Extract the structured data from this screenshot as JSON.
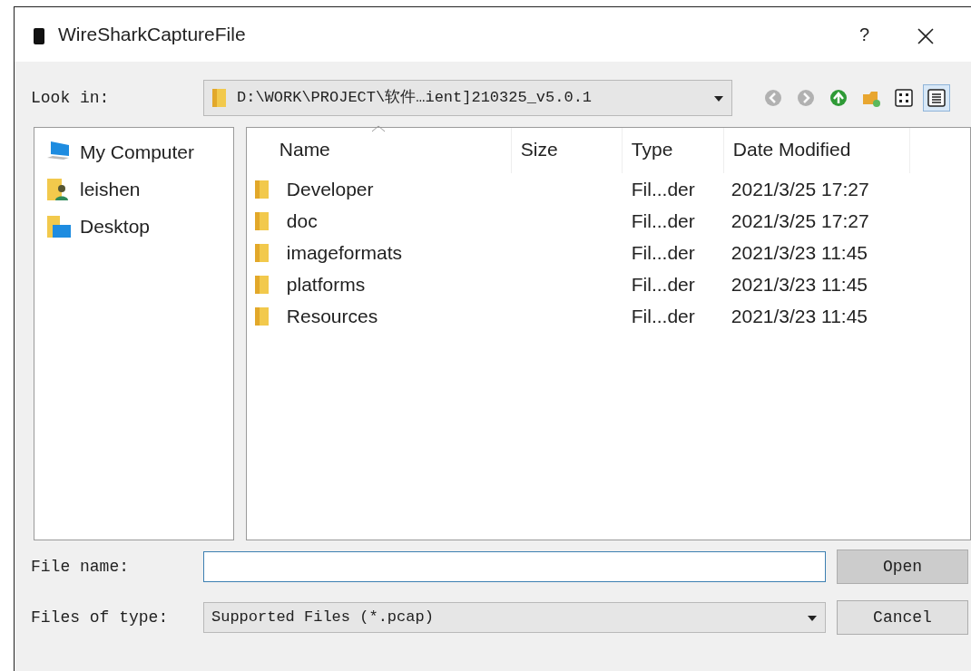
{
  "window": {
    "title": "WireSharkCaptureFile",
    "help": "?"
  },
  "look_in": {
    "label": "Look in:",
    "path": "D:\\WORK\\PROJECT\\软件…ient]210325_v5.0.1"
  },
  "toolbar": [
    {
      "kind": "back",
      "disabled": true,
      "selected": false
    },
    {
      "kind": "forward",
      "disabled": true,
      "selected": false
    },
    {
      "kind": "up",
      "disabled": false,
      "selected": false
    },
    {
      "kind": "new-folder",
      "disabled": false,
      "selected": false
    },
    {
      "kind": "icon-view",
      "disabled": false,
      "selected": false
    },
    {
      "kind": "detail-view",
      "disabled": false,
      "selected": true
    }
  ],
  "sidebar": {
    "items": [
      {
        "kind": "computer",
        "label": "My Computer"
      },
      {
        "kind": "user",
        "label": "leishen"
      },
      {
        "kind": "desktop",
        "label": "Desktop"
      }
    ]
  },
  "table": {
    "columns": [
      {
        "label": "Name",
        "sorted": true
      },
      {
        "label": "Size",
        "sorted": false
      },
      {
        "label": "Type",
        "sorted": false
      },
      {
        "label": "Date Modified",
        "sorted": false
      }
    ],
    "rows": [
      {
        "name": "Developer",
        "type": "Fil...der",
        "date": "2021/3/25 17:27"
      },
      {
        "name": "doc",
        "type": "Fil...der",
        "date": "2021/3/25 17:27"
      },
      {
        "name": "imageformats",
        "type": "Fil...der",
        "date": "2021/3/23 11:45"
      },
      {
        "name": "platforms",
        "type": "Fil...der",
        "date": "2021/3/23 11:45"
      },
      {
        "name": "Resources",
        "type": "Fil...der",
        "date": "2021/3/23 11:45"
      }
    ]
  },
  "file_name": {
    "label": "File name:"
  },
  "file_type": {
    "label": "Files of type:",
    "value": "Supported Files (*.pcap)"
  },
  "buttons": [
    {
      "label": "Open",
      "kind": "primary"
    },
    {
      "label": "Cancel",
      "kind": "secondary"
    }
  ]
}
